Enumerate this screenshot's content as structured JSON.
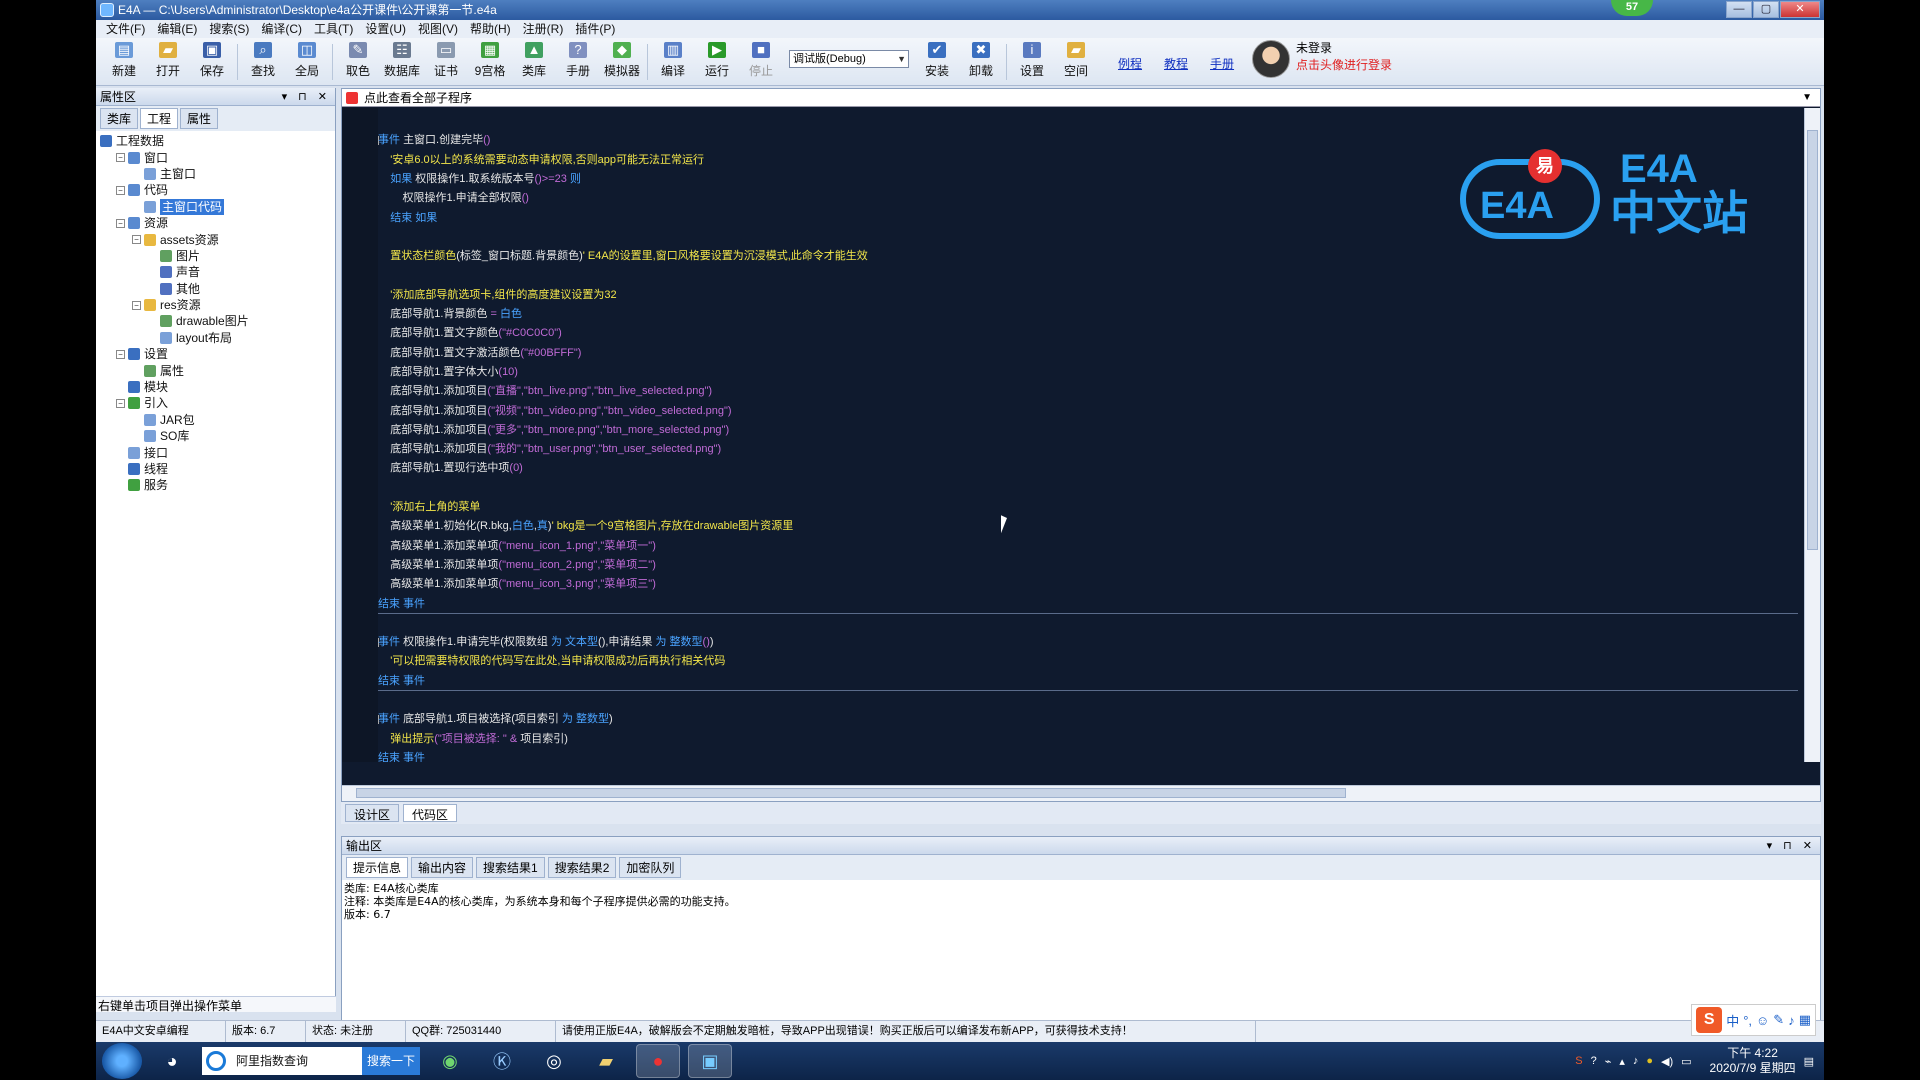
{
  "window": {
    "title": "E4A — C:\\Users\\Administrator\\Desktop\\e4a公开课件\\公开课第一节.e4a",
    "badge": "57"
  },
  "menu": [
    "文件(F)",
    "编辑(E)",
    "搜索(S)",
    "编译(C)",
    "工具(T)",
    "设置(U)",
    "视图(V)",
    "帮助(H)",
    "注册(R)",
    "插件(P)"
  ],
  "toolbar": {
    "new": "新建",
    "open": "打开",
    "save": "保存",
    "find": "查找",
    "global": "全局",
    "pick_color": "取色",
    "database": "数据库",
    "cert": "证书",
    "ninepatch": "9宫格",
    "classlib": "类库",
    "manual": "手册",
    "emulator": "模拟器",
    "compile": "编译",
    "run": "运行",
    "stop": "停止",
    "build_mode": "调试版(Debug)",
    "install": "安装",
    "uninstall": "卸载",
    "settings": "设置",
    "space": "空间",
    "link_examples": "例程",
    "link_tutorials": "教程",
    "link_manual": "手册",
    "login_status": "未登录",
    "login_hint": "点击头像进行登录"
  },
  "left_panel": {
    "title": "属性区",
    "tabs": [
      "类库",
      "工程",
      "属性"
    ],
    "tree": [
      {
        "label": "工程数据",
        "depth": 0,
        "icon": "project-icon",
        "color": "#3a6fc0"
      },
      {
        "label": "窗口",
        "depth": 1,
        "icon": "window-icon",
        "color": "#5a8ad0",
        "expander": "-"
      },
      {
        "label": "主窗口",
        "depth": 2,
        "icon": "form-icon",
        "color": "#7aa0d8"
      },
      {
        "label": "代码",
        "depth": 1,
        "icon": "code-icon",
        "color": "#5a8ad0",
        "expander": "-"
      },
      {
        "label": "主窗口代码",
        "depth": 2,
        "icon": "code-file-icon",
        "color": "#7aa0d8",
        "selected": true
      },
      {
        "label": "资源",
        "depth": 1,
        "icon": "resource-icon",
        "color": "#5a8ad0",
        "expander": "-"
      },
      {
        "label": "assets资源",
        "depth": 2,
        "icon": "folder-icon",
        "color": "#e8b840",
        "expander": "-"
      },
      {
        "label": "图片",
        "depth": 3,
        "icon": "image-icon",
        "color": "#60a060"
      },
      {
        "label": "声音",
        "depth": 3,
        "icon": "sound-icon",
        "color": "#5070c0"
      },
      {
        "label": "其他",
        "depth": 3,
        "icon": "question-icon",
        "color": "#5070c0"
      },
      {
        "label": "res资源",
        "depth": 2,
        "icon": "folder-icon",
        "color": "#e8b840",
        "expander": "-"
      },
      {
        "label": "drawable图片",
        "depth": 3,
        "icon": "image-icon",
        "color": "#60a060"
      },
      {
        "label": "layout布局",
        "depth": 3,
        "icon": "layout-icon",
        "color": "#7aa0d8"
      },
      {
        "label": "设置",
        "depth": 1,
        "icon": "info-icon",
        "color": "#3a6fc0",
        "expander": "-"
      },
      {
        "label": "属性",
        "depth": 2,
        "icon": "gear-icon",
        "color": "#60a060"
      },
      {
        "label": "模块",
        "depth": 1,
        "icon": "module-icon",
        "color": "#3a6fc0"
      },
      {
        "label": "引入",
        "depth": 1,
        "icon": "import-icon",
        "color": "#40a040",
        "expander": "-"
      },
      {
        "label": "JAR包",
        "depth": 2,
        "icon": "jar-icon",
        "color": "#7aa0d8"
      },
      {
        "label": "SO库",
        "depth": 2,
        "icon": "so-icon",
        "color": "#7aa0d8"
      },
      {
        "label": "接口",
        "depth": 1,
        "icon": "interface-icon",
        "color": "#7aa0d8"
      },
      {
        "label": "线程",
        "depth": 1,
        "icon": "thread-icon",
        "color": "#3a6fc0"
      },
      {
        "label": "服务",
        "depth": 1,
        "icon": "service-icon",
        "color": "#40a040"
      }
    ],
    "status": "右键单击项目弹出操作菜单"
  },
  "code": {
    "header": "点此查看全部子程序",
    "lines": [
      {
        "n": "1",
        "parts": []
      },
      {
        "n": "2",
        "fold": true,
        "parts": [
          [
            "kw",
            "事件 "
          ],
          [
            "plain",
            "主窗口.创建完毕"
          ],
          [
            "num",
            "()"
          ]
        ]
      },
      {
        "n": "3",
        "parts": [
          [
            "cm",
            "    '安卓6.0以上的系统需要动态申请权限,否则app可能无法正常运行"
          ]
        ]
      },
      {
        "n": "4",
        "parts": [
          [
            "kw",
            "    如果 "
          ],
          [
            "plain",
            "权限操作1.取系统版本号"
          ],
          [
            "num",
            "()>=23 "
          ],
          [
            "kw",
            "则"
          ]
        ]
      },
      {
        "n": "5",
        "parts": [
          [
            "plain",
            "        权限操作1.申请全部权限"
          ],
          [
            "num",
            "()"
          ]
        ]
      },
      {
        "n": "6",
        "parts": [
          [
            "kw",
            "    结束 如果"
          ]
        ]
      },
      {
        "n": "7",
        "parts": []
      },
      {
        "n": "8",
        "parts": [
          [
            "cm",
            "    置状态栏颜色"
          ],
          [
            "plain",
            "(标签_窗口标题.背景颜色)"
          ],
          [
            "cm",
            "' E4A的设置里,窗口风格要设置为沉浸模式,此命令才能生效"
          ]
        ]
      },
      {
        "n": "9",
        "parts": []
      },
      {
        "n": "10",
        "parts": [
          [
            "cm",
            "    '添加底部导航选项卡,组件的高度建议设置为32"
          ]
        ]
      },
      {
        "n": "11",
        "parts": [
          [
            "plain",
            "    底部导航1.背景颜色 "
          ],
          [
            "num",
            "= "
          ],
          [
            "kw",
            "白色"
          ]
        ]
      },
      {
        "n": "12",
        "parts": [
          [
            "plain",
            "    底部导航1.置文字颜色"
          ],
          [
            "str",
            "(\"#C0C0C0\")"
          ]
        ]
      },
      {
        "n": "13",
        "parts": [
          [
            "plain",
            "    底部导航1.置文字激活颜色"
          ],
          [
            "str",
            "(\"#00BFFF\")"
          ]
        ]
      },
      {
        "n": "14",
        "parts": [
          [
            "plain",
            "    底部导航1.置字体大小"
          ],
          [
            "num",
            "(10)"
          ]
        ]
      },
      {
        "n": "15",
        "parts": [
          [
            "plain",
            "    底部导航1.添加项目"
          ],
          [
            "str",
            "(\"直播\",\"btn_live.png\",\"btn_live_selected.png\")"
          ]
        ]
      },
      {
        "n": "16",
        "parts": [
          [
            "plain",
            "    底部导航1.添加项目"
          ],
          [
            "str",
            "(\"视频\",\"btn_video.png\",\"btn_video_selected.png\")"
          ]
        ]
      },
      {
        "n": "17",
        "parts": [
          [
            "plain",
            "    底部导航1.添加项目"
          ],
          [
            "str",
            "(\"更多\",\"btn_more.png\",\"btn_more_selected.png\")"
          ]
        ]
      },
      {
        "n": "18",
        "parts": [
          [
            "plain",
            "    底部导航1.添加项目"
          ],
          [
            "str",
            "(\"我的\",\"btn_user.png\",\"btn_user_selected.png\")"
          ]
        ]
      },
      {
        "n": "19",
        "parts": [
          [
            "plain",
            "    底部导航1.置现行选中项"
          ],
          [
            "num",
            "(0)"
          ]
        ]
      },
      {
        "n": "20",
        "parts": []
      },
      {
        "n": "21",
        "parts": [
          [
            "cm",
            "    '添加右上角的菜单"
          ]
        ]
      },
      {
        "n": "22",
        "parts": [
          [
            "plain",
            "    高级菜单1.初始化(R.bkg,"
          ],
          [
            "kw",
            "白色"
          ],
          [
            "plain",
            ","
          ],
          [
            "kw",
            "真"
          ],
          [
            "plain",
            ")"
          ],
          [
            "cm",
            "' bkg是一个9宫格图片,存放在drawable图片资源里"
          ]
        ]
      },
      {
        "n": "23",
        "parts": [
          [
            "plain",
            "    高级菜单1.添加菜单项"
          ],
          [
            "str",
            "(\"menu_icon_1.png\",\"菜单项一\")"
          ]
        ]
      },
      {
        "n": "24",
        "parts": [
          [
            "plain",
            "    高级菜单1.添加菜单项"
          ],
          [
            "str",
            "(\"menu_icon_2.png\",\"菜单项二\")"
          ]
        ]
      },
      {
        "n": "25",
        "parts": [
          [
            "plain",
            "    高级菜单1.添加菜单项"
          ],
          [
            "str",
            "(\"menu_icon_3.png\",\"菜单项三\")"
          ]
        ]
      },
      {
        "n": "26",
        "sep": true,
        "parts": [
          [
            "kw",
            "结束 事件"
          ]
        ]
      },
      {
        "n": "27",
        "parts": []
      },
      {
        "n": "28",
        "fold": true,
        "parts": [
          [
            "kw",
            "事件 "
          ],
          [
            "plain",
            "权限操作1.申请完毕(权限数组 "
          ],
          [
            "kw",
            "为 文本型"
          ],
          [
            "plain",
            "(),申请结果 "
          ],
          [
            "kw",
            "为 整数型"
          ],
          [
            "num",
            "()"
          ],
          [
            "plain",
            ")"
          ]
        ]
      },
      {
        "n": "29",
        "parts": [
          [
            "cm",
            "    '可以把需要特权限的代码写在此处,当申请权限成功后再执行相关代码"
          ]
        ]
      },
      {
        "n": "30",
        "sep": true,
        "parts": [
          [
            "kw",
            "结束 事件"
          ]
        ]
      },
      {
        "n": "31",
        "parts": []
      },
      {
        "n": "32",
        "fold": true,
        "parts": [
          [
            "kw",
            "事件 "
          ],
          [
            "plain",
            "底部导航1.项目被选择(项目索引 "
          ],
          [
            "kw",
            "为 整数型"
          ],
          [
            "plain",
            ")"
          ]
        ]
      },
      {
        "n": "33",
        "parts": [
          [
            "cm",
            "    弹出提示"
          ],
          [
            "str",
            "(\"项目被选择: \" & "
          ],
          [
            "plain",
            "项目索引)"
          ]
        ]
      },
      {
        "n": "34",
        "parts": [
          [
            "kw",
            "结束 事件"
          ]
        ]
      }
    ]
  },
  "logo": {
    "cloud_text": "E4A",
    "easy": "易",
    "brand_line1": "E4A",
    "brand_line2": "中文站"
  },
  "view_tabs": [
    "设计区",
    "代码区"
  ],
  "output": {
    "title": "输出区",
    "tabs": [
      "提示信息",
      "输出内容",
      "搜索结果1",
      "搜索结果2",
      "加密队列"
    ],
    "lines": [
      "类库: E4A核心类库",
      "注释: 本类库是E4A的核心类库，为系统本身和每个子程序提供必需的功能支持。",
      "版本: 6.7"
    ]
  },
  "status_bar": [
    "E4A中文安卓编程",
    "版本: 6.7",
    "状态: 未注册",
    "QQ群: 725031440",
    "请使用正版E4A，破解版会不定期触发暗桩，导致APP出现错误！购买正版后可以编译发布新APP，可获得技术支持！"
  ],
  "ime": {
    "mode": "中"
  },
  "taskbar": {
    "search_text": "阿里指数查询",
    "search_button": "搜索一下",
    "time": "下午 4:22",
    "date": "2020/7/9 星期四"
  }
}
